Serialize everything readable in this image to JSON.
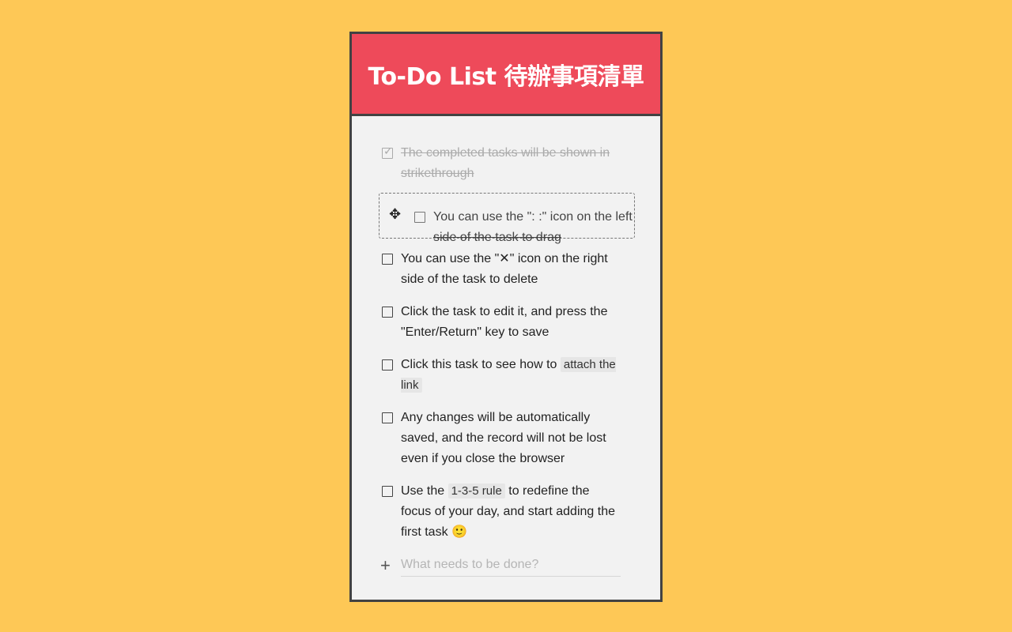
{
  "header": {
    "title": "To-Do List 待辦事項清單"
  },
  "tasks": [
    {
      "text": "The completed tasks will be shown in strikethrough",
      "completed": true
    },
    {
      "text_line1": "You can use the \": :\" icon on the left",
      "text_line2": "side of the task to drag",
      "completed": false,
      "dragging": true
    },
    {
      "text": "You can use the \"✕\" icon on the right side of the task to delete",
      "completed": false
    },
    {
      "text": "Click the task to edit it, and press the \"Enter/Return\" key to save",
      "completed": false
    },
    {
      "text_before": "Click this task to see how to",
      "chip": "attach the link",
      "completed": false
    },
    {
      "text": "Any changes will be automatically saved, and the record will not be lost even if you close the browser",
      "completed": false
    },
    {
      "text_before": "Use the",
      "chip": "1-3-5 rule",
      "text_after": "to redefine the focus of your day, and start adding the first task 🙂",
      "completed": false
    }
  ],
  "add": {
    "placeholder": "What needs to be done?",
    "icon": "plus-icon"
  },
  "icons": {
    "drag": "move-icon",
    "check": "checkmark-icon"
  },
  "colors": {
    "background": "#FEC856",
    "header": "#EE4A5A",
    "border": "#424242",
    "card": "#F2F2F2"
  }
}
